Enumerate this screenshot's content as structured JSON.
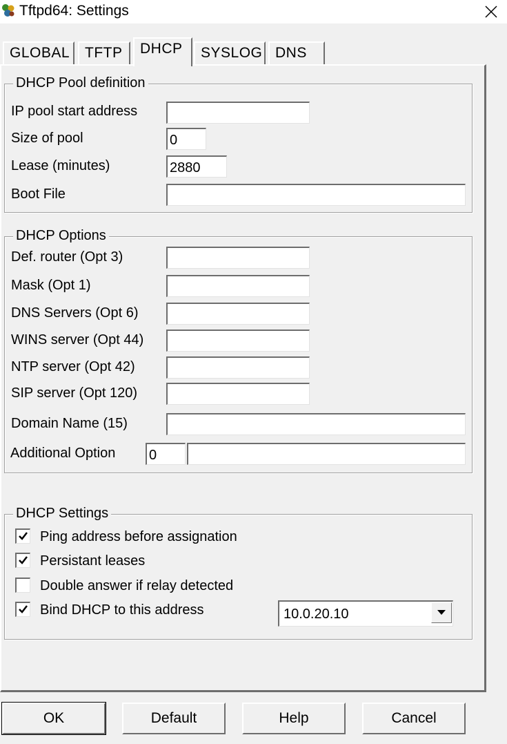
{
  "window": {
    "title": "Tftpd64: Settings"
  },
  "tabs": [
    "GLOBAL",
    "TFTP",
    "DHCP",
    "SYSLOG",
    "DNS"
  ],
  "pool": {
    "title": "DHCP Pool definition",
    "ip_start": {
      "label": "IP pool start address",
      "value": ""
    },
    "size": {
      "label": "Size of pool",
      "value": "0"
    },
    "lease": {
      "label": "Lease (minutes)",
      "value": "2880"
    },
    "boot": {
      "label": "Boot File",
      "value": ""
    }
  },
  "options": {
    "title": "DHCP Options",
    "router": {
      "label": "Def. router (Opt 3)",
      "value": ""
    },
    "mask": {
      "label": "Mask (Opt 1)",
      "value": ""
    },
    "dns": {
      "label": "DNS Servers (Opt 6)",
      "value": ""
    },
    "wins": {
      "label": "WINS server (Opt 44)",
      "value": ""
    },
    "ntp": {
      "label": "NTP server (Opt 42)",
      "value": ""
    },
    "sip": {
      "label": "SIP server (Opt 120)",
      "value": ""
    },
    "domain": {
      "label": "Domain Name (15)",
      "value": ""
    },
    "additional": {
      "label": "Additional Option",
      "number": "0",
      "value": ""
    }
  },
  "settings": {
    "title": "DHCP Settings",
    "ping": {
      "label": "Ping address before assignation",
      "checked": true
    },
    "persistant": {
      "label": "Persistant leases",
      "checked": true
    },
    "double": {
      "label": "Double answer if relay detected",
      "checked": false
    },
    "bind": {
      "label": "Bind DHCP to this address",
      "checked": true,
      "selected": "10.0.20.10"
    }
  },
  "buttons": {
    "ok": "OK",
    "default": "Default",
    "help": "Help",
    "cancel": "Cancel"
  },
  "icons": {
    "app": "tftpd-app-icon",
    "close": "close-icon",
    "check": "checkmark-icon",
    "dropdown": "chevron-down-icon"
  }
}
